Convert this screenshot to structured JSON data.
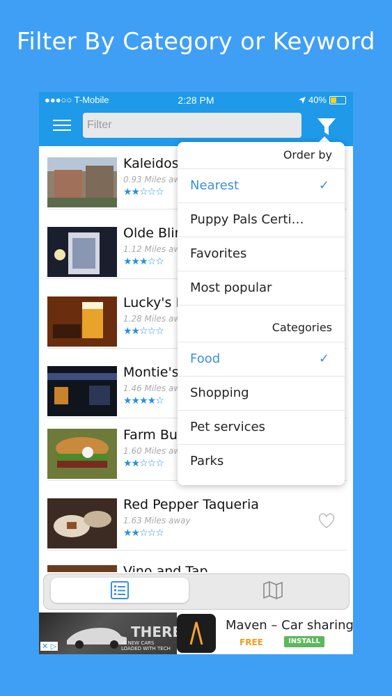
{
  "headline": "Filter By Category or Keyword",
  "status": {
    "carrier": "●●●○○ T-Mobile",
    "time": "2:28 PM",
    "battery": "40%"
  },
  "search": {
    "placeholder": "Filter",
    "value": ""
  },
  "list": [
    {
      "title": "Kaleidos",
      "distance": "0.93 Miles aw",
      "stars": "★★☆☆☆"
    },
    {
      "title": "Olde Blin",
      "distance": "1.12 Miles aw",
      "stars": "★★★☆☆"
    },
    {
      "title": "Lucky's E",
      "distance": "1.28 Miles aw",
      "stars": "★★☆☆☆"
    },
    {
      "title": "Montie's",
      "distance": "1.46 Miles aw",
      "stars": "★★★★☆"
    },
    {
      "title": "Farm Bu",
      "distance": "1.60 Miles aw",
      "stars": "★★☆☆☆"
    },
    {
      "title": "Red Pepper Taqueria",
      "distance": "1.63 Miles away",
      "stars": "★★☆☆☆"
    },
    {
      "title": "Vino and Tap",
      "distance": "",
      "stars": ""
    }
  ],
  "dropdown": {
    "order_header": "Order by",
    "order_items": [
      {
        "label": "Nearest",
        "selected": true
      },
      {
        "label": "Puppy Pals Certi…",
        "selected": false
      },
      {
        "label": "Favorites",
        "selected": false
      },
      {
        "label": "Most popular",
        "selected": false
      }
    ],
    "categories_header": "Categories",
    "category_items": [
      {
        "label": "Food",
        "selected": true
      },
      {
        "label": "Shopping",
        "selected": false
      },
      {
        "label": "Pet services",
        "selected": false
      },
      {
        "label": "Parks",
        "selected": false
      }
    ],
    "check": "✓"
  },
  "ad": {
    "title": "Maven – Car sharing",
    "free": "FREE",
    "install": "INSTALL",
    "image_text": "THERE",
    "image_sub": "IN NEW CARS\nLOADED WITH TECH",
    "choice": "✕ ▷"
  },
  "colors": {
    "background": "#3f9ff5",
    "navbar": "#1e9ae8",
    "accent": "#3a8ee6",
    "stars": "#2b90d9"
  }
}
